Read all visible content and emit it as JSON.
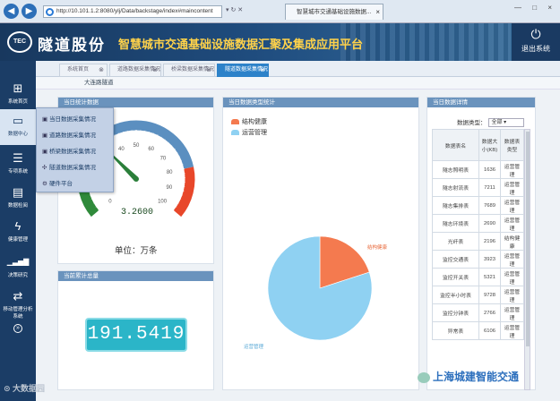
{
  "browser": {
    "address": "http://10.101.1.2:8080/ylj/Data/backstage/index#maincontent",
    "tab_title": "智慧城市交通基础设施数据...",
    "back_icon": "back-arrow-icon",
    "forward_icon": "forward-arrow-icon",
    "window_controls": "— □ ×"
  },
  "header": {
    "logo_text": "TEC",
    "company": "隧道股份",
    "system_title": "智慧城市交通基础设施数据汇聚及集成应用平台",
    "exit_label": "退出系统",
    "exit_icon": "power-icon"
  },
  "sidebar": {
    "items": [
      {
        "label": "系统首页",
        "icon": "windows-grid-icon",
        "glyph": "⊞"
      },
      {
        "label": "数据中心",
        "icon": "monitor-icon",
        "glyph": "▭"
      },
      {
        "label": "专项系统",
        "icon": "list-icon",
        "glyph": "☰"
      },
      {
        "label": "数据检阅",
        "icon": "table-icon",
        "glyph": "▤"
      },
      {
        "label": "健康管理",
        "icon": "lightning-icon",
        "glyph": "ϟ"
      },
      {
        "label": "决策研究",
        "icon": "bar-signal-icon",
        "glyph": "▁▃▅▇"
      },
      {
        "label": "移动管理分析系统",
        "icon": "sync-icon",
        "glyph": "⇄"
      },
      {
        "label": "",
        "icon": "chevron-right-circle-icon",
        "glyph": "»"
      }
    ]
  },
  "flyout": {
    "items": [
      {
        "label": "当日数据采集情况",
        "icon": "image-icon",
        "glyph": "▣"
      },
      {
        "label": "道路数据采集情况",
        "icon": "road-icon",
        "glyph": "▣"
      },
      {
        "label": "桥梁数据采集情况",
        "icon": "bridge-icon",
        "glyph": "▣"
      },
      {
        "label": "隧道数据采集情况",
        "icon": "tunnel-icon",
        "glyph": "✣"
      },
      {
        "label": "硬件平台",
        "icon": "hardware-icon",
        "glyph": "⚙"
      }
    ]
  },
  "page_tabs": [
    {
      "label": "系统首页",
      "active": false
    },
    {
      "label": "道路数据采集情况",
      "active": false
    },
    {
      "label": "桥梁数据采集情况",
      "active": false
    },
    {
      "label": "隧道数据采集情况",
      "active": true
    }
  ],
  "breadcrumb": "大连路隧道",
  "panels": {
    "today_stats": "当日统计数据",
    "type_stats": "当日数据类型统计",
    "detail": "当日数据详情",
    "cumulative": "当前累计总量"
  },
  "gauge": {
    "value": "3.2600",
    "unit_label": "单位：万条",
    "level": 0.326,
    "ticks": [
      "0",
      "10",
      "20",
      "30",
      "40",
      "50",
      "60",
      "70",
      "80",
      "90",
      "100"
    ],
    "colors": {
      "low": "#2f8a3a",
      "mid": "#5b8fc0",
      "high": "#e8472a"
    }
  },
  "counter": "191.5419",
  "pie": {
    "series": [
      {
        "name": "结构健康",
        "value": 20,
        "color": "#f47a4f"
      },
      {
        "name": "运营管理",
        "value": 80,
        "color": "#8fd1f2"
      }
    ]
  },
  "detail": {
    "type_label": "数据类型：",
    "type_value": "全部",
    "headers": [
      "数据表名",
      "数据大小(KB)",
      "数据表类型"
    ],
    "rows": [
      [
        "隧志照明表",
        "1636",
        "运营管理"
      ],
      [
        "隧志射流表",
        "7211",
        "运营管理"
      ],
      [
        "隧志集排表",
        "7689",
        "运营管理"
      ],
      [
        "隧志环境表",
        "2690",
        "运营管理"
      ],
      [
        "光纤表",
        "2196",
        "结构健康"
      ],
      [
        "监控交通表",
        "3923",
        "运营管理"
      ],
      [
        "监控开关表",
        "5321",
        "运营管理"
      ],
      [
        "监控半小时表",
        "9728",
        "运营管理"
      ],
      [
        "监控分钟表",
        "2766",
        "运营管理"
      ],
      [
        "异常表",
        "6106",
        "运营管理"
      ]
    ]
  },
  "watermark": "上海城建智能交通",
  "watermark2": "大数据园"
}
